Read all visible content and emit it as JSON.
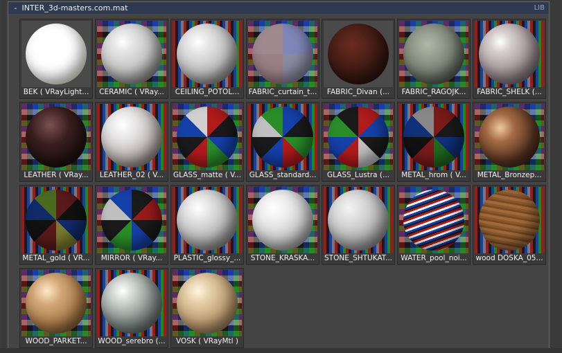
{
  "window": {
    "title": " -  INTER_3d-masters.com.mat",
    "lib_label": "LIB"
  },
  "materials": [
    {
      "label": "BEK  ( VRayLight...",
      "style": "white"
    },
    {
      "label": "CERAMIC  ( VRay...",
      "style": "ceramic"
    },
    {
      "label": "CEILING_POTOL...",
      "style": "ceiling"
    },
    {
      "label": "FABRIC_curtain_t...",
      "style": "curtain"
    },
    {
      "label": "FABRIC_Divan  (...",
      "style": "divan"
    },
    {
      "label": "FABRIC_RAGOJK...",
      "style": "ragojka"
    },
    {
      "label": "FABRIC_SHELK  (...",
      "style": "shelk"
    },
    {
      "label": "LEATHER  ( VRay...",
      "style": "leather"
    },
    {
      "label": "LEATHER_02  ( V...",
      "style": "leather2"
    },
    {
      "label": "GLASS_matte  ( V...",
      "style": "glass"
    },
    {
      "label": "GLASS_standard...",
      "style": "glass2"
    },
    {
      "label": "GLASS_Lustra  (...",
      "style": "glass3"
    },
    {
      "label": "METAL_hrom  ( V...",
      "style": "hrom"
    },
    {
      "label": "METAL_Bronzep...",
      "style": "bronze"
    },
    {
      "label": "METAL_gold  ( VR...",
      "style": "gold"
    },
    {
      "label": "MIRROR  ( VRay...",
      "style": "mirror"
    },
    {
      "label": "PLASTIC_glossy_...",
      "style": "plastic"
    },
    {
      "label": "STONE_KRASKA...",
      "style": "kraska"
    },
    {
      "label": "STONE_SHTUKAT...",
      "style": "shtukat"
    },
    {
      "label": "WATER_pool_noi...",
      "style": "water"
    },
    {
      "label": "wood DOSKA_05...",
      "style": "doska"
    },
    {
      "label": "WOOD_PARKET...",
      "style": "parket"
    },
    {
      "label": "WOOD_serebro  (...",
      "style": "serebro"
    },
    {
      "label": "VOSK  ( VRayMtl )",
      "style": "vosk"
    }
  ]
}
